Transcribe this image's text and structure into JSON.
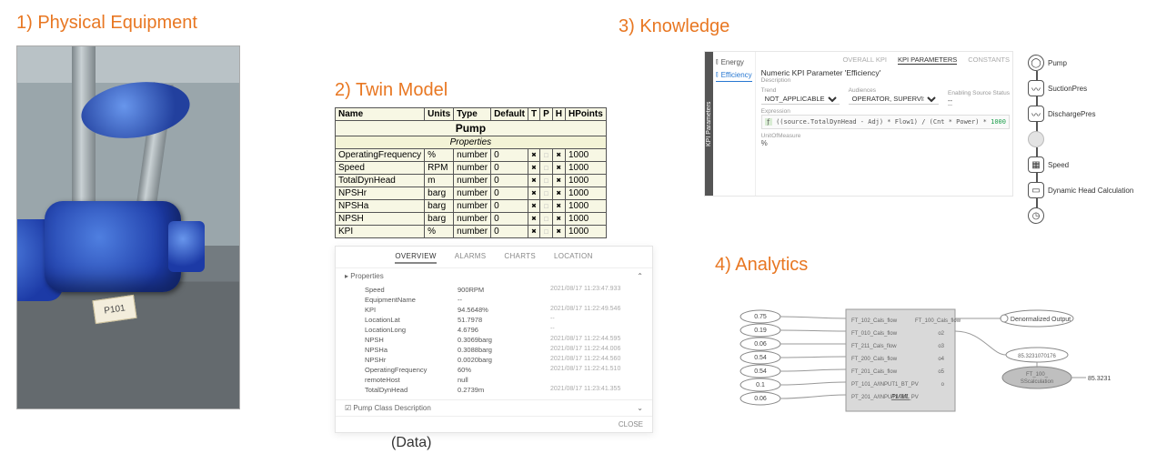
{
  "headings": {
    "h1": "1) Physical Equipment",
    "h2": "2) Twin Model",
    "h3": "3) Knowledge",
    "h4": "4) Analytics"
  },
  "physical": {
    "tag": "P101"
  },
  "twin_table": {
    "title": "Pump",
    "subtitle": "Properties",
    "headers": [
      "Name",
      "Units",
      "Type",
      "Default",
      "T",
      "P",
      "H",
      "HPoints"
    ],
    "rows": [
      {
        "name": "OperatingFrequency",
        "units": "%",
        "type": "number",
        "default": "0",
        "t": true,
        "p": false,
        "h": true,
        "hp": "1000"
      },
      {
        "name": "Speed",
        "units": "RPM",
        "type": "number",
        "default": "0",
        "t": true,
        "p": false,
        "h": true,
        "hp": "1000"
      },
      {
        "name": "TotalDynHead",
        "units": "m",
        "type": "number",
        "default": "0",
        "t": true,
        "p": false,
        "h": true,
        "hp": "1000"
      },
      {
        "name": "NPSHr",
        "units": "barg",
        "type": "number",
        "default": "0",
        "t": true,
        "p": false,
        "h": true,
        "hp": "1000"
      },
      {
        "name": "NPSHa",
        "units": "barg",
        "type": "number",
        "default": "0",
        "t": true,
        "p": false,
        "h": true,
        "hp": "1000"
      },
      {
        "name": "NPSH",
        "units": "barg",
        "type": "number",
        "default": "0",
        "t": true,
        "p": false,
        "h": true,
        "hp": "1000"
      },
      {
        "name": "KPI",
        "units": "%",
        "type": "number",
        "default": "0",
        "t": true,
        "p": false,
        "h": true,
        "hp": "1000"
      }
    ]
  },
  "data_panel": {
    "tabs": [
      "OVERVIEW",
      "ALARMS",
      "CHARTS",
      "LOCATION"
    ],
    "active_tab": 0,
    "section": "Properties",
    "props": [
      {
        "k": "Speed",
        "v": "900RPM",
        "ts": "2021/08/17 11:23:47.933"
      },
      {
        "k": "EquipmentName",
        "v": "--",
        "ts": ""
      },
      {
        "k": "KPI",
        "v": "94.5648%",
        "ts": "2021/08/17 11:22:49.546"
      },
      {
        "k": "LocationLat",
        "v": "51.7978",
        "ts": "--"
      },
      {
        "k": "LocationLong",
        "v": "4.6796",
        "ts": "--"
      },
      {
        "k": "NPSH",
        "v": "0.3069barg",
        "ts": "2021/08/17 11:22:44.595"
      },
      {
        "k": "NPSHa",
        "v": "0.3088barg",
        "ts": "2021/08/17 11:22:44.006"
      },
      {
        "k": "NPSHr",
        "v": "0.0020barg",
        "ts": "2021/08/17 11:22:44.560"
      },
      {
        "k": "OperatingFrequency",
        "v": "60%",
        "ts": "2021/08/17 11:22:41.510"
      },
      {
        "k": "remoteHost",
        "v": "null",
        "ts": ""
      },
      {
        "k": "TotalDynHead",
        "v": "0.2739m",
        "ts": "2021/08/17 11:23:41.355"
      }
    ],
    "footer_left": "Pump Class Description",
    "footer_right": "CLOSE",
    "caption": "(Data)"
  },
  "knowledge": {
    "topnav": [
      "OVERALL KPI",
      "KPI PARAMETERS",
      "CONSTANTS"
    ],
    "topnav_active": 1,
    "side_tab": "KPI Parameters",
    "side_items": [
      {
        "icon": "ic-energy",
        "label": "Energy",
        "active": false
      },
      {
        "icon": "ic-eff",
        "label": "Efficiency",
        "active": true
      }
    ],
    "title": "Numeric KPI Parameter 'Efficiency'",
    "title_sub": "Description",
    "trend_lbl": "Trend",
    "trend_val": "NOT_APPLICABLE",
    "aud_lbl": "Audiences",
    "aud_val": "OPERATOR, SUPERVISOR, MANAGEMENT",
    "est_lbl": "Enabling Source Status",
    "est_val": "--",
    "expr_lbl": "Expression",
    "expr_pre": "((source.TotalDynHead - Adj) * Flow1) / (Cnt * Power) * ",
    "expr_num": "1000",
    "uom_lbl": "UnitOfMeasure",
    "uom_val": "%"
  },
  "knowledge_graph": [
    {
      "icon": "◯",
      "label": "Pump",
      "round": true
    },
    {
      "icon": "〰",
      "label": "SuctionPres",
      "round": false
    },
    {
      "icon": "〰",
      "label": "DischargePres",
      "round": false
    },
    {
      "icon": "",
      "label": "",
      "round": true,
      "grey": true
    },
    {
      "icon": "▦",
      "label": "Speed",
      "round": false
    },
    {
      "icon": "▭",
      "label": "Dynamic Head Calculation",
      "round": false
    },
    {
      "icon": "◷",
      "label": "",
      "round": true
    }
  ],
  "analytics": {
    "inputs": [
      "0.75",
      "0.19",
      "0.06",
      "0.54",
      "0.54",
      "0.1",
      "0.06"
    ],
    "block_fields": [
      "FT_102_Cals_flow",
      "FT_010_Cals_flow",
      "FT_211_Cals_flow",
      "FT_200_Cals_flow",
      "FT_201_Cals_flow",
      "PT_101_A/INPUT1_BT_PV",
      "PT_201_A/INPUT1_BT_PV"
    ],
    "block_out_tops": [
      "FT_100_Cals_flow"
    ],
    "block_right": [
      "o2",
      "o3",
      "o4",
      "o5",
      "o"
    ],
    "block_label": "PMML",
    "out1": "Denormalized Output",
    "out2": "85.3231070176",
    "out3": "FT_100_SScalculation",
    "out_val": "85.3231"
  }
}
